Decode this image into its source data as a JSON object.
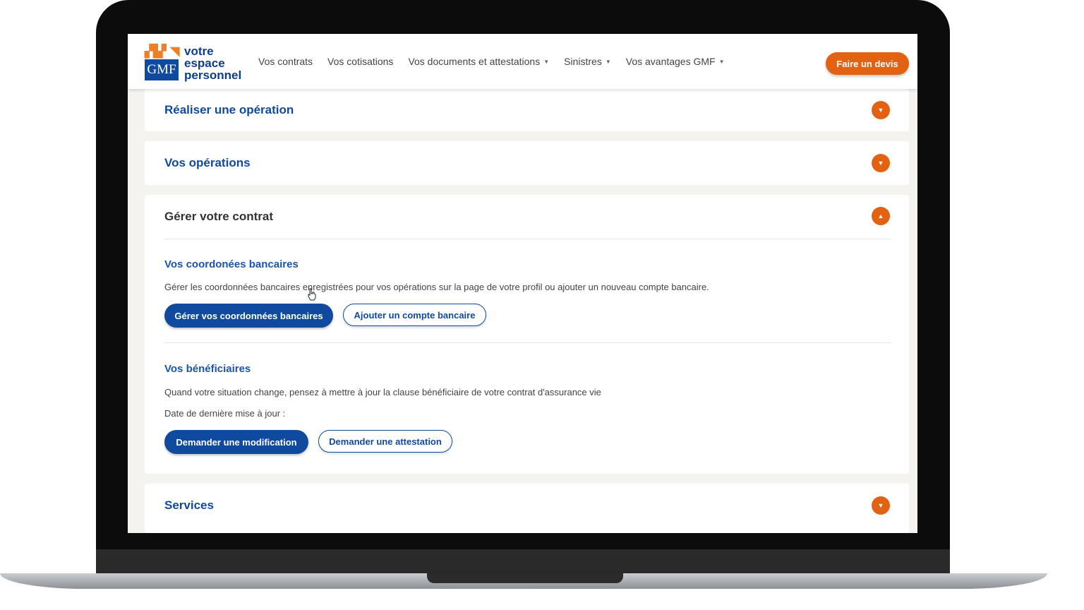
{
  "logo": {
    "line1": "votre",
    "line2": "espace",
    "line3": "personnel",
    "mark_text": "GMF",
    "brand_blue": "#0f4a9e",
    "brand_orange": "#f07f24"
  },
  "nav": {
    "items": [
      {
        "label": "Vos contrats",
        "has_dropdown": false
      },
      {
        "label": "Vos cotisations",
        "has_dropdown": false
      },
      {
        "label": "Vos documents et attestations",
        "has_dropdown": true
      },
      {
        "label": "Sinistres",
        "has_dropdown": true
      },
      {
        "label": "Vos avantages GMF",
        "has_dropdown": true
      }
    ],
    "cta_label": "Faire un devis",
    "cta_color": "#e36211"
  },
  "accordion": {
    "realiser": {
      "title": "Réaliser une opération",
      "expanded": false
    },
    "operations": {
      "title": "Vos opérations",
      "expanded": false
    },
    "gerer": {
      "title": "Gérer votre contrat",
      "expanded": true,
      "bancaires": {
        "title": "Vos coordonées bancaires",
        "description": "Gérer les coordonnées bancaires enregistrées pour vos opérations sur la page de votre profil ou ajouter un nouveau compte bancaire.",
        "primary_label": "Gérer vos coordonnées bancaires",
        "secondary_label": "Ajouter un compte bancaire"
      },
      "beneficiaires": {
        "title": "Vos bénéficiaires",
        "description": "Quand votre situation change, pensez à mettre à jour la clause bénéficiaire de votre contrat d'assurance vie",
        "date_label": "Date de dernière mise à jour :",
        "primary_label": "Demander une modification",
        "secondary_label": "Demander une attestation"
      }
    },
    "services": {
      "title": "Services",
      "expanded": false
    }
  }
}
